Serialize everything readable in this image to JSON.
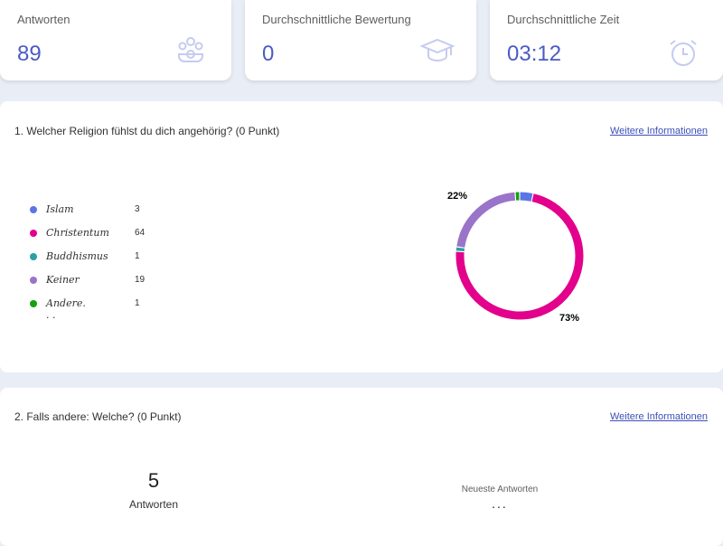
{
  "stats": [
    {
      "label": "Antworten",
      "value": "89",
      "icon": "people-group-icon"
    },
    {
      "label": "Durchschnittliche Bewertung",
      "value": "0",
      "icon": "graduation-cap-icon"
    },
    {
      "label": "Durchschnittliche Zeit",
      "value": "03:12",
      "icon": "alarm-clock-icon"
    }
  ],
  "question1": {
    "title": "1. Welcher Religion fühlst du dich angehörig? (0 Punkt)",
    "more_link": "Weitere Informationen",
    "legend": [
      {
        "name": "Islam",
        "count": "3",
        "color": "#5b74e8"
      },
      {
        "name": "Christentum",
        "count": "64",
        "color": "#e3008c"
      },
      {
        "name": "Buddhismus",
        "count": "1",
        "color": "#2aa0a4"
      },
      {
        "name": "Keiner",
        "count": "19",
        "color": "#9a74c9"
      },
      {
        "name": "Andere. . .",
        "count": "1",
        "color": "#13a10e"
      }
    ],
    "donut_labels": {
      "keiner": "22%",
      "christentum": "73%"
    }
  },
  "question2": {
    "title": "2. Falls andere: Welche? (0 Punkt)",
    "more_link": "Weitere Informationen",
    "count": "5",
    "count_label": "Antworten",
    "recent_label": "Neueste Antworten",
    "recent_placeholder": "..."
  },
  "chart_data": {
    "type": "pie",
    "categories": [
      "Islam",
      "Christentum",
      "Buddhismus",
      "Keiner",
      "Andere. . ."
    ],
    "values": [
      3,
      64,
      1,
      19,
      1
    ],
    "colors": [
      "#5b74e8",
      "#e3008c",
      "#2aa0a4",
      "#9a74c9",
      "#13a10e"
    ],
    "data_labels": [
      "",
      "73%",
      "",
      "22%",
      ""
    ]
  }
}
